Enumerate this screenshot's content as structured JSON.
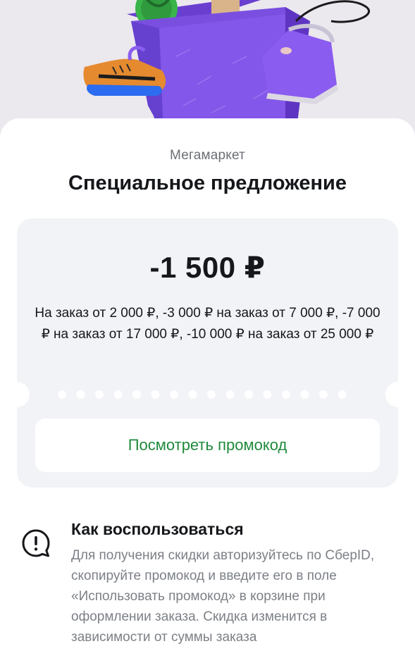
{
  "brand": "Мегамаркет",
  "title": "Специальное предложение",
  "offer": {
    "amount": "-1 500 ₽",
    "conditions": "На заказ от 2 000 ₽, -3 000 ₽ на заказ от 7 000 ₽, -7 000 ₽ на заказ от 17 000 ₽, -10 000 ₽ на заказ от 25 000 ₽"
  },
  "promo_button_label": "Посмотреть промокод",
  "howto": {
    "icon": "alert-bubble-icon",
    "title": "Как воспользоваться",
    "text": "Для получения скидки авторизуйтесь по СберID, скопируйте промокод и введите его в поле «Использовать промокод» в корзине при оформлении заказа. Скидка изменится в зависимости от суммы заказа"
  },
  "colors": {
    "accent_green": "#1f8a3c",
    "box_purple": "#7a4fe0",
    "coupon_bg": "#f2f3f6"
  }
}
